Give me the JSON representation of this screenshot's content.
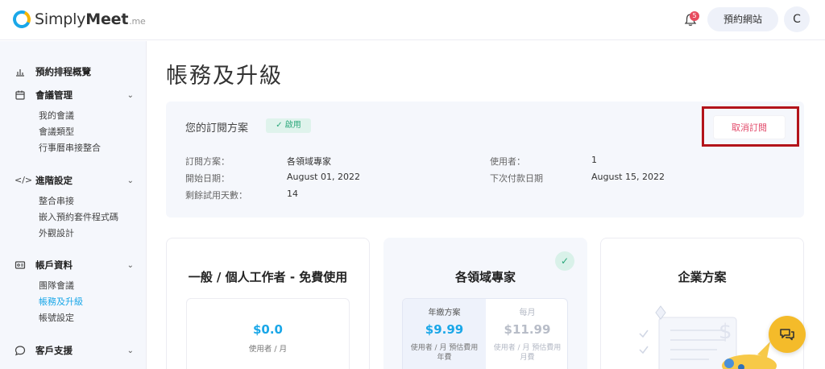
{
  "header": {
    "logo": {
      "brand_light": "Simply",
      "brand_bold": "Meet",
      "tld": ".me"
    },
    "notification_count": "5",
    "book_site_label": "預約網站",
    "avatar_initial": "C"
  },
  "sidebar": {
    "groups": [
      {
        "label": "預約排程概覽",
        "icon": "chart-icon",
        "items": []
      },
      {
        "label": "會議管理",
        "icon": "calendar-icon",
        "items": [
          "我的會議",
          "會議類型",
          "行事曆串接整合"
        ]
      },
      {
        "label": "進階設定",
        "icon": "code-icon",
        "items": [
          "整合串接",
          "嵌入預約套件程式碼",
          "外觀設計"
        ]
      },
      {
        "label": "帳戶資料",
        "icon": "id-card-icon",
        "items": [
          "團隊會議",
          "帳務及升級",
          "帳號設定"
        ]
      },
      {
        "label": "客戶支援",
        "icon": "chat-bubble-icon",
        "items": []
      }
    ],
    "active_item": "帳務及升級"
  },
  "main": {
    "title": "帳務及升級",
    "subscription": {
      "title": "您的訂閱方案",
      "status": "啟用",
      "fields": [
        {
          "label": "訂閱方案：",
          "value": "各領域專家"
        },
        {
          "label": "開始日期：",
          "value": "August 01, 2022"
        },
        {
          "label": "剩餘試用天數：",
          "value": "14"
        },
        {
          "label": "使用者：",
          "value": "1"
        },
        {
          "label": "下次付款日期",
          "value": "August 15, 2022"
        }
      ],
      "cancel_label": "取消訂閱"
    },
    "plans": [
      {
        "title": "一般 / 個人工作者 - 免費使用",
        "price": "$0.0",
        "unit": "使用者 / 月"
      },
      {
        "title": "各領域專家",
        "options": [
          {
            "label": "年繳方案",
            "price": "$9.99",
            "unit": "使用者 / 月 預估費用 年費"
          },
          {
            "label": "每月",
            "price": "$11.99",
            "unit": "使用者 / 月 預估費用 月費"
          }
        ]
      },
      {
        "title": "企業方案"
      }
    ]
  },
  "colors": {
    "accent": "#1aa7e8",
    "danger": "#e24a6a",
    "highlight_box": "#b3141b",
    "chat_button": "#f4bb2a"
  }
}
